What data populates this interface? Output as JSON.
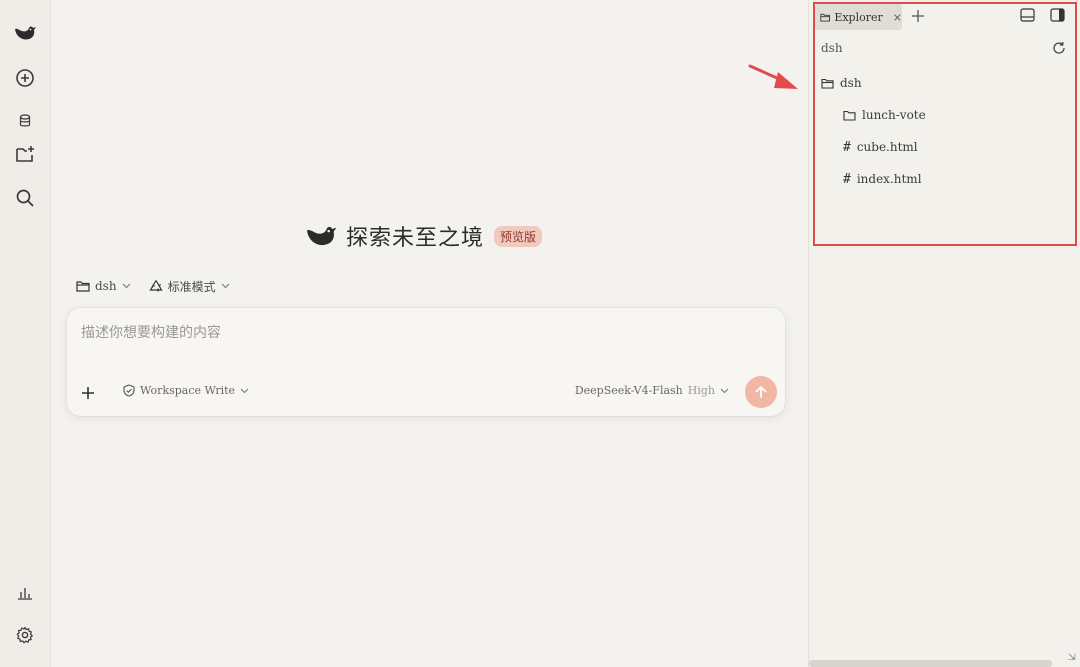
{
  "sidebar": {
    "items": [
      {
        "name": "logo",
        "icon": "whale-icon"
      },
      {
        "name": "new-chat",
        "icon": "plus-circle-icon"
      },
      {
        "name": "database",
        "icon": "database-icon"
      },
      {
        "name": "new-project",
        "icon": "folder-plus-icon"
      },
      {
        "name": "search",
        "icon": "search-icon"
      },
      {
        "name": "stats",
        "icon": "bar-chart-icon"
      },
      {
        "name": "settings",
        "icon": "gear-icon"
      }
    ]
  },
  "hero": {
    "title": "探索未至之境",
    "badge": "预览版"
  },
  "context": {
    "folder": "dsh",
    "mode": "标准模式"
  },
  "composer": {
    "placeholder": "描述你想要构建的内容",
    "permission": "Workspace Write",
    "model": "DeepSeek-V4-Flash",
    "effort": "High"
  },
  "explorer": {
    "tab_label": "Explorer",
    "tab_close": "×",
    "path": "dsh",
    "tree": [
      {
        "type": "folder",
        "label": "dsh",
        "depth": 0
      },
      {
        "type": "folder",
        "label": "lunch-vote",
        "depth": 1
      },
      {
        "type": "file",
        "label": "cube.html",
        "depth": 1
      },
      {
        "type": "file",
        "label": "index.html",
        "depth": 1
      }
    ],
    "file_glyph": "#",
    "resize_glyph": "⇲"
  },
  "colors": {
    "accent": "#efb7a4",
    "highlight": "#e24b4b",
    "background": "#f4f2ee"
  }
}
